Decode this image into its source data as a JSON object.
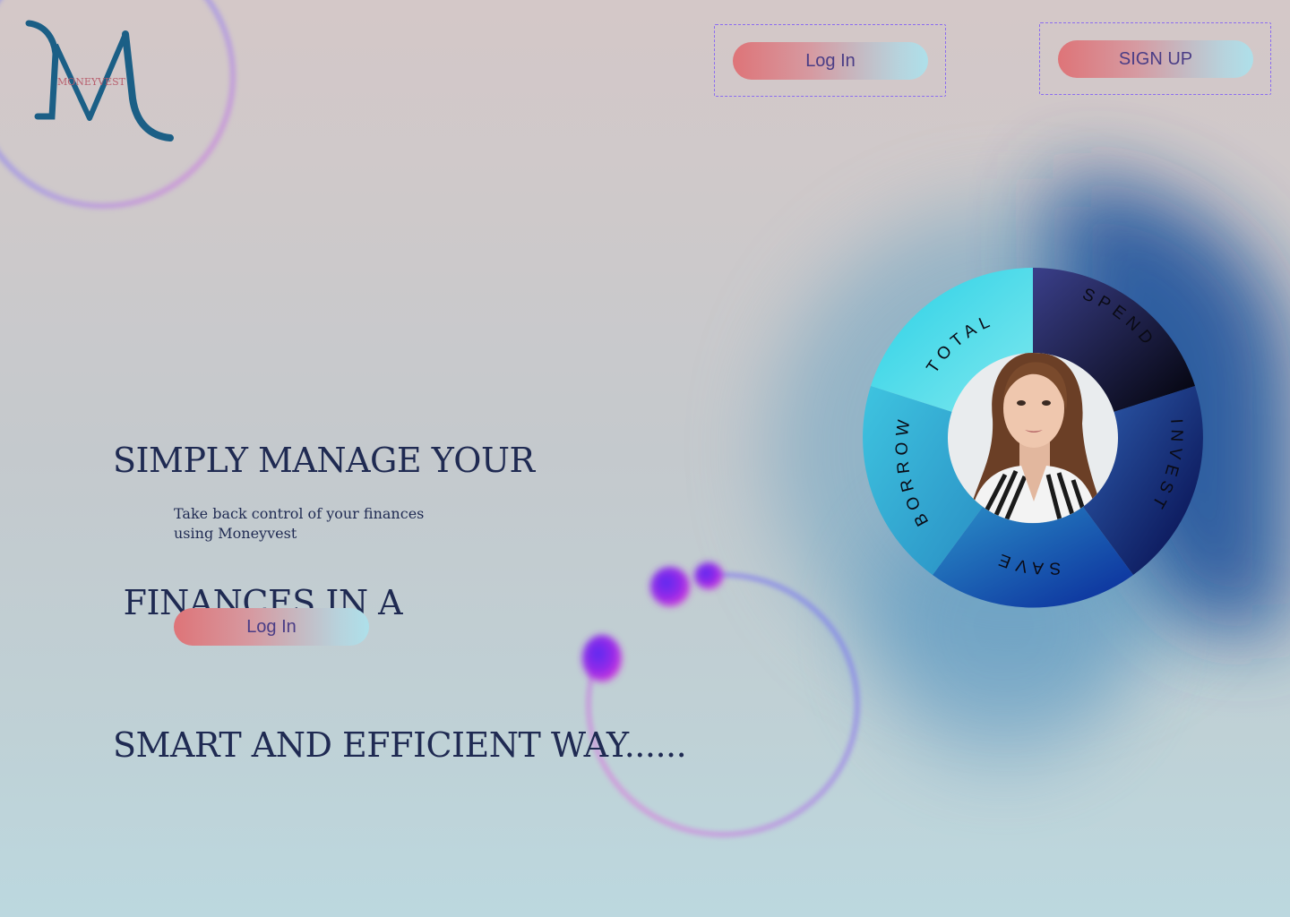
{
  "brand": {
    "logo_letter": "M",
    "name": "MONEYVEST"
  },
  "header": {
    "login_label": "Log In",
    "signup_label": "SIGN UP"
  },
  "hero": {
    "headline_lines": [
      "SIMPLY MANAGE YOUR",
      " FINANCES IN A",
      "SMART AND EFFICIENT WAY......"
    ],
    "subtext_lines": [
      "Take back control of your finances",
      "using Moneyvest"
    ],
    "cta_label": "Log In"
  },
  "wheel": {
    "segments": [
      {
        "label": "SPEND",
        "color": "#0b0f2e"
      },
      {
        "label": "INVEST",
        "color": "#1d3a8a"
      },
      {
        "label": "SAVE",
        "color": "#1f5fb8"
      },
      {
        "label": "BORROW",
        "color": "#2aa9d4"
      },
      {
        "label": "TOTAL",
        "color": "#3fd8e6"
      }
    ],
    "avatar": "woman-portrait"
  },
  "colors": {
    "headline": "#1f2a52",
    "button_text": "#4a3d86",
    "logo": "#1b5f86",
    "frame": "#8b6cf0"
  }
}
